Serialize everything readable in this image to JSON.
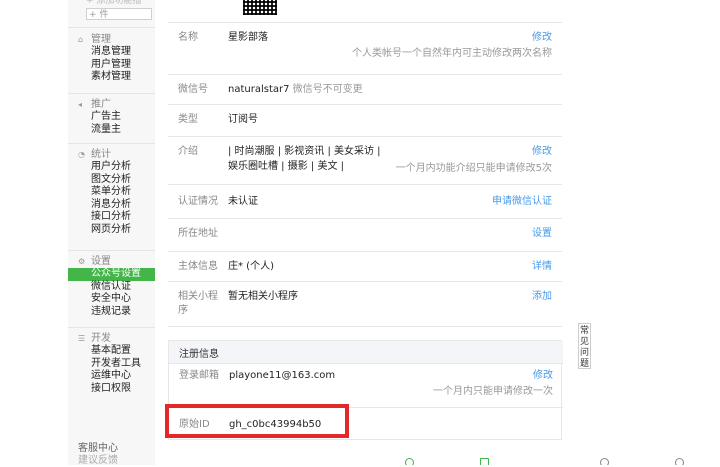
{
  "sidebar": {
    "top_add_label": "+ 添加功能插",
    "top_plus_label": "+ 件",
    "sections": [
      {
        "title": "管理",
        "icon": "folder-icon",
        "items": [
          "消息管理",
          "用户管理",
          "素材管理"
        ]
      },
      {
        "title": "推广",
        "icon": "megaphone-icon",
        "items": [
          "广告主",
          "流量主"
        ]
      },
      {
        "title": "统计",
        "icon": "stats-icon",
        "items": [
          "用户分析",
          "图文分析",
          "菜单分析",
          "消息分析",
          "接口分析",
          "网页分析"
        ]
      },
      {
        "title": "设置",
        "icon": "settings-icon",
        "items": [
          "公众号设置",
          "微信认证",
          "安全中心",
          "违规记录"
        ]
      },
      {
        "title": "开发",
        "icon": "code-icon",
        "items": [
          "基本配置",
          "开发者工具",
          "运维中心",
          "接口权限"
        ]
      }
    ],
    "bottom_label": "客服中心",
    "bottom_label_cut": "建议反馈"
  },
  "account": {
    "name_label": "名称",
    "name_value": "星影部落",
    "name_action": "修改",
    "name_note": "个人类帐号一个自然年内可主动修改两次名称",
    "wechat_label": "微信号",
    "wechat_value": "naturalstar7",
    "wechat_note": "微信号不可变更",
    "type_label": "类型",
    "type_value": "订阅号",
    "intro_label": "介绍",
    "intro_line1": "| 时尚潮服 | 影视资讯 | 美女采访 |",
    "intro_line2": "娱乐圈吐槽 | 摄影 | 美文 |",
    "intro_action": "修改",
    "intro_note": "一个月内功能介绍只能申请修改5次",
    "cert_label": "认证情况",
    "cert_value": "未认证",
    "cert_action": "申请微信认证",
    "location_label": "所在地址",
    "location_action": "设置",
    "subject_label": "主体信息",
    "subject_value": "庄* (个人)",
    "subject_action": "详情",
    "miniprogram_label_line1": "相关小程",
    "miniprogram_label_line2": "序",
    "miniprogram_value": "暂无相关小程序",
    "miniprogram_action": "添加"
  },
  "registration": {
    "header": "注册信息",
    "email_label": "登录邮箱",
    "email_value": "playone11@163.com",
    "email_action": "修改",
    "email_note": "一个月内只能申请修改一次",
    "id_label": "原始ID",
    "id_value": "gh_c0bc43994b50"
  },
  "right_tab_label": "常见问题",
  "colors": {
    "accent_green": "#44b549",
    "link_blue": "#459ae9",
    "highlight_red": "#e3282b"
  }
}
